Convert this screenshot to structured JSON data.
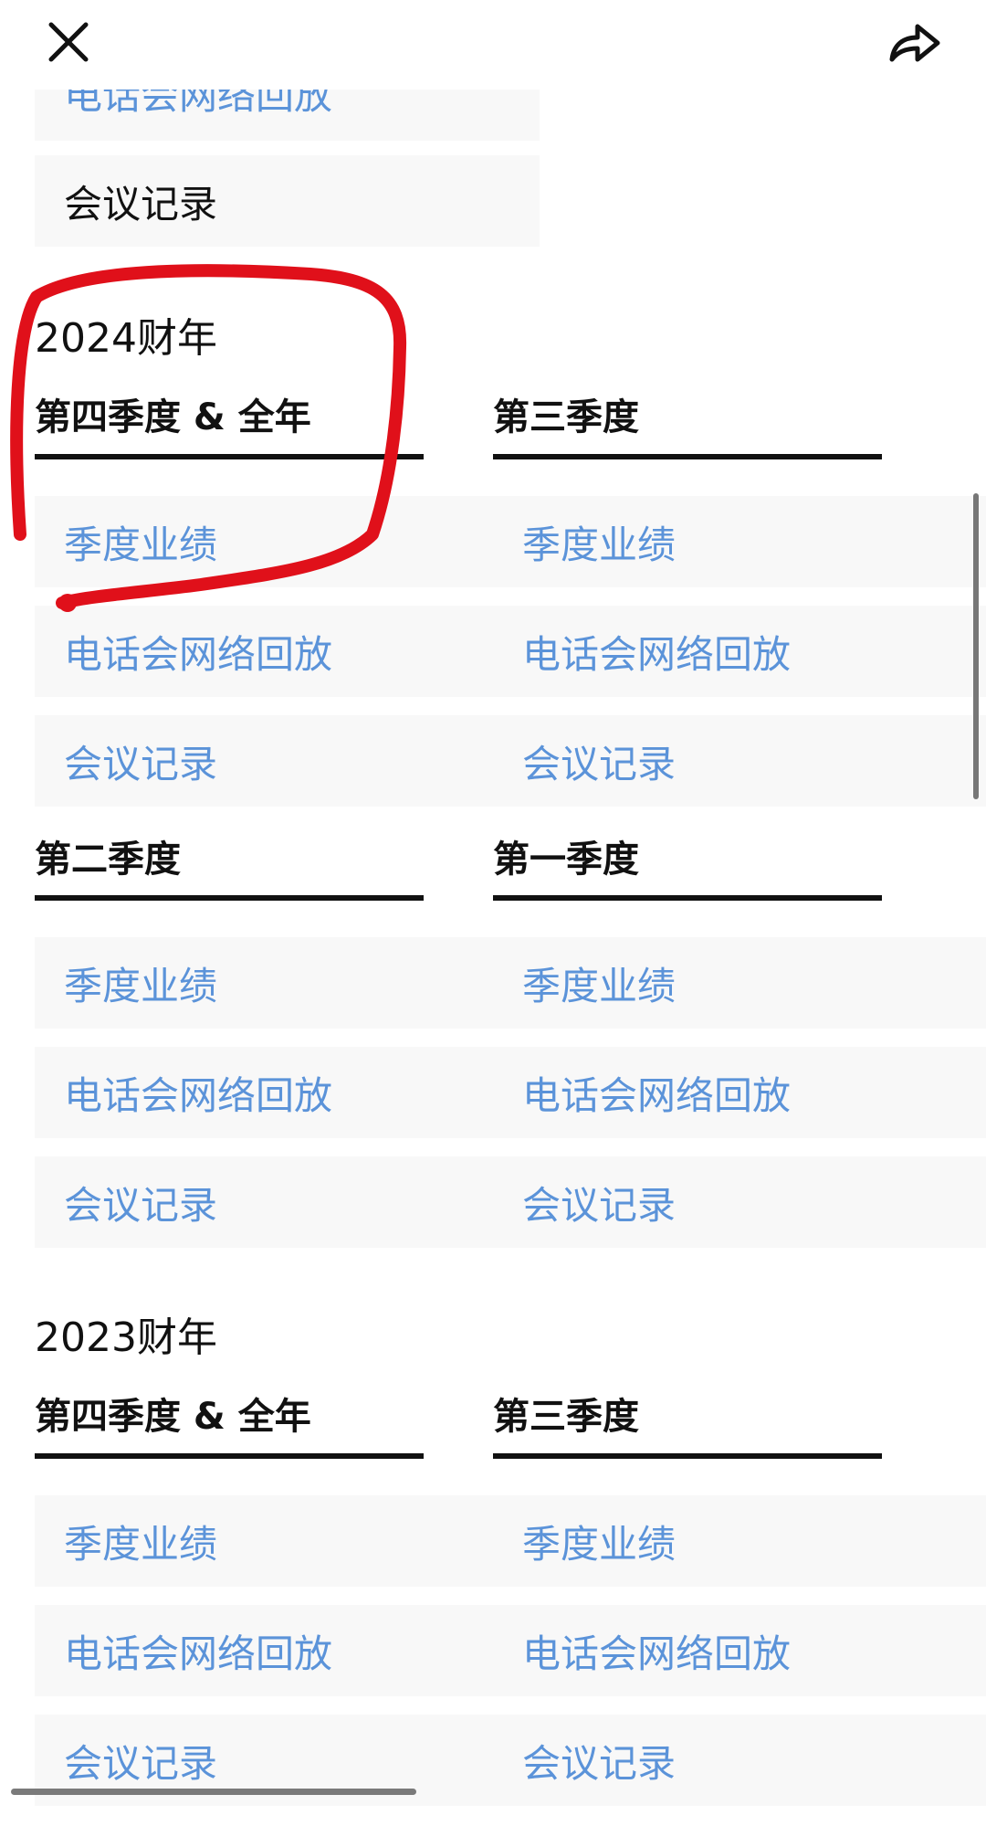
{
  "top_bar": {
    "close_icon": "close-icon",
    "share_icon": "share-icon"
  },
  "partial_prev": {
    "replay": "电话会网络回放",
    "transcript": "会议记录"
  },
  "fy2024": {
    "year": "2024财年",
    "q4": {
      "heading": "第四季度 & 全年",
      "results": "季度业绩",
      "replay": "电话会网络回放",
      "transcript": "会议记录"
    },
    "q3": {
      "heading": "第三季度",
      "results": "季度业绩",
      "replay": "电话会网络回放",
      "transcript": "会议记录"
    },
    "q2": {
      "heading": "第二季度",
      "results": "季度业绩",
      "replay": "电话会网络回放",
      "transcript": "会议记录"
    },
    "q1": {
      "heading": "第一季度",
      "results": "季度业绩",
      "replay": "电话会网络回放",
      "transcript": "会议记录"
    }
  },
  "fy2023": {
    "year": "2023财年",
    "q4": {
      "heading": "第四季度 & 全年",
      "results": "季度业绩",
      "replay": "电话会网络回放",
      "transcript": "会议记录"
    },
    "q3": {
      "heading": "第三季度",
      "results": "季度业绩",
      "replay": "电话会网络回放",
      "transcript": "会议记录"
    }
  },
  "colors": {
    "link": "#5b93d9",
    "text": "#111111",
    "item_bg": "#f8f8f8",
    "annotation": "#e0101a"
  }
}
